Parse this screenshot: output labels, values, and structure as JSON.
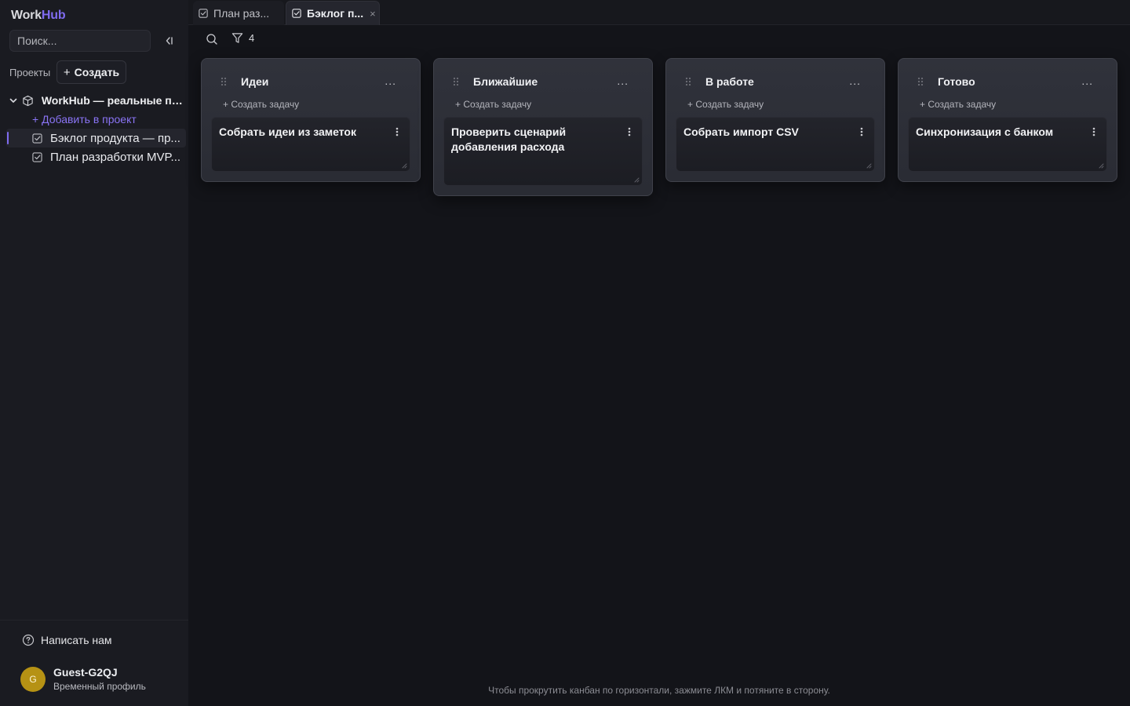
{
  "sidebar": {
    "logo": {
      "part1": "Work",
      "part2": "Hub"
    },
    "search_placeholder": "Поиск...",
    "projects_label": "Проекты",
    "create_label": "Создать",
    "project": {
      "name": "WorkHub — реальные при..."
    },
    "add_to_project": "+ Добавить в проект",
    "boards": [
      {
        "label": "Бэклог продукта — пр...",
        "active": true
      },
      {
        "label": "План разработки MVP...",
        "active": false
      }
    ],
    "write_us": "Написать нам",
    "profile": {
      "initial": "G",
      "name": "Guest-G2QJ",
      "subtitle": "Временный профиль"
    }
  },
  "tabs": [
    {
      "label": "План раз...",
      "active": false
    },
    {
      "label": "Бэклог п...",
      "active": true,
      "close": "×"
    }
  ],
  "toolbar": {
    "filter_count": "4"
  },
  "columns": [
    {
      "title": "Идеи",
      "menu": "...",
      "add_task": "+ Создать задачу",
      "cards": [
        {
          "title": "Собрать идеи из заметок"
        }
      ]
    },
    {
      "title": "Ближайшие",
      "menu": "...",
      "add_task": "+ Создать задачу",
      "cards": [
        {
          "title": "Проверить сценарий добавления расхода"
        }
      ]
    },
    {
      "title": "В работе",
      "menu": "...",
      "add_task": "+ Создать задачу",
      "cards": [
        {
          "title": "Собрать импорт CSV"
        }
      ]
    },
    {
      "title": "Готово",
      "menu": "...",
      "add_task": "+ Создать задачу",
      "cards": [
        {
          "title": "Синхронизация с банком"
        }
      ]
    }
  ],
  "hint": "Чтобы прокрутить канбан по горизонтали, зажмите ЛКМ и потяните в сторону.",
  "colors": {
    "accent": "#7f6bf0",
    "background": "#131419",
    "sidebar": "#1a1b21",
    "avatar": "#b69214"
  }
}
